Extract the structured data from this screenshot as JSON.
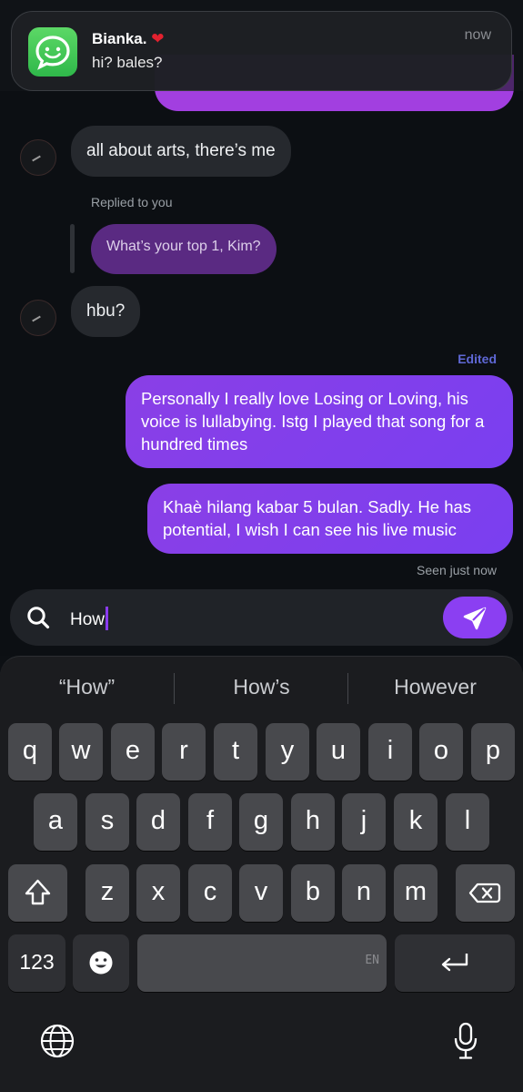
{
  "notification": {
    "app_icon": "chat-app-icon",
    "sender": "Bianka.",
    "sender_emoji": "❤️",
    "message": "hi? bales?",
    "time": "now"
  },
  "chat": {
    "messages": [
      {
        "from": "them",
        "text": "all about arts, there’s me"
      },
      {
        "from": "me",
        "type": "reply-quote",
        "label": "Replied to you",
        "text": "What’s your top 1, Kim?"
      },
      {
        "from": "them",
        "text": "hbu?"
      },
      {
        "from": "me",
        "text": "Personally I really love Losing or Loving, his voice is lullabying. Istg I played that song for a hundred times",
        "edited": "Edited"
      },
      {
        "from": "me",
        "text": "Khaè hilang kabar 5 bulan. Sadly. He has potential, I wish I can see his live music"
      }
    ],
    "seen_status": "Seen just now"
  },
  "composer": {
    "value": "How",
    "search_icon": "search-icon",
    "send_icon": "send-icon"
  },
  "keyboard": {
    "suggestions": [
      "“How”",
      "How’s",
      "However"
    ],
    "row1": [
      "q",
      "w",
      "e",
      "r",
      "t",
      "y",
      "u",
      "i",
      "o",
      "p"
    ],
    "row2": [
      "a",
      "s",
      "d",
      "f",
      "g",
      "h",
      "j",
      "k",
      "l"
    ],
    "row3": [
      "z",
      "x",
      "c",
      "v",
      "b",
      "n",
      "m"
    ],
    "numbers_label": "123",
    "space_lang": "EN",
    "icons": [
      "shift-icon",
      "backspace-icon",
      "emoji-icon",
      "return-icon",
      "globe-icon",
      "microphone-icon"
    ]
  },
  "colors": {
    "accent": "#8b3ff2",
    "bubble_out_start": "#8a3fe6",
    "bubble_out_end": "#7a3ff0",
    "bubble_in": "#26292e",
    "edited": "#5f68d6"
  }
}
